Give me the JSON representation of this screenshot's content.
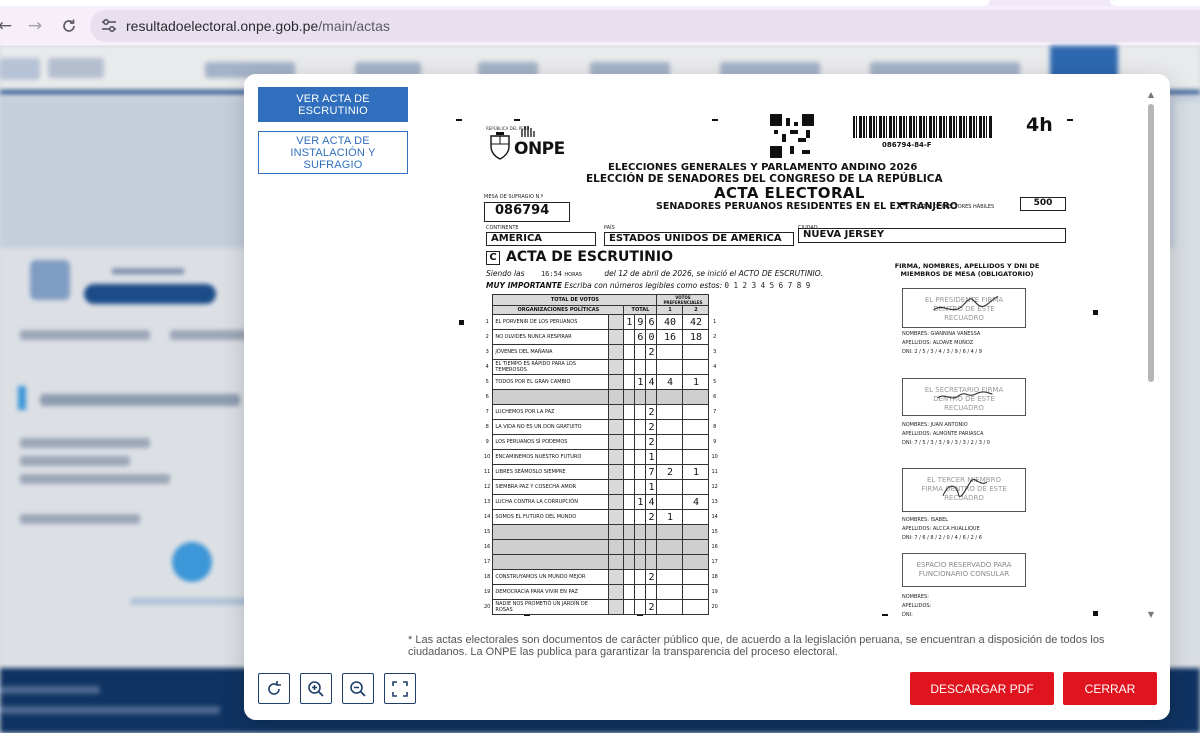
{
  "browser": {
    "url_host": "resultadoelectoral.onpe.gob.pe",
    "url_path": "/main/actas"
  },
  "modal": {
    "tab_acta_escrutinio": "VER ACTA DE ESCRUTINIO",
    "tab_acta_instalacion": "VER ACTA DE INSTALACIÓN Y SUFRAGIO",
    "note": "* Las actas electorales son documentos de carácter público que, de acuerdo a la legislación peruana, se encuentran a disposición de todos los ciudadanos. La ONPE las publica para garantizar la transparencia del proceso electoral.",
    "download_label": "DESCARGAR PDF",
    "close_label": "CERRAR"
  },
  "acta": {
    "corner_code": "4h",
    "barcode_number": "086794-84-F",
    "republica": "REPÚBLICA DEL PERÚ",
    "onpe": "ONPE",
    "title1": "ELECCIONES GENERALES Y PARLAMENTO ANDINO 2026",
    "title2": "ELECCIÓN DE SENADORES DEL CONGRESO DE LA REPÚBLICA",
    "title3": "ACTA ELECTORAL",
    "title4": "SENADORES PERUANOS RESIDENTES EN EL EXTRANJERO",
    "mesa_label": "MESA DE SUFRAGIO N.º",
    "mesa_value": "086794",
    "electores_label": "TOTAL DE ELECTORES HÁBILES",
    "electores_value": "500",
    "continente_label": "CONTINENTE",
    "continente_value": "AMERICA",
    "pais_label": "PAÍS",
    "pais_value": "ESTADOS UNIDOS DE AMERICA",
    "ciudad_label": "CIUDAD",
    "ciudad_value": "NUEVA JERSEY",
    "section_letter": "C",
    "section_title": "ACTA DE ESCRUTINIO",
    "siendo_prefix": "Siendo las",
    "siendo_time": "16:54",
    "siendo_horas": "HORAS",
    "siendo_suffix": "del 12 de abril de 2026, se inició el ACTO DE ESCRUTINIO.",
    "muy_importante": "MUY IMPORTANTE",
    "muy_text": "Escriba con números legibles como estos:",
    "digits_sample": "0 1 2 3 4 5 6 7 8 9",
    "table_header_total_votos": "TOTAL DE VOTOS",
    "table_header_votos_pref": "VOTOS PREFERENCIALES",
    "table_header_org": "ORGANIZACIONES POLÍTICAS",
    "table_header_total": "TOTAL",
    "table_header_p1": "1",
    "table_header_p2": "2",
    "rows": [
      {
        "n": "1",
        "org": "EL PORVENIR DE LOS PERUANOS",
        "total": [
          "1",
          "9",
          "6"
        ],
        "p1": "40",
        "p2": "42"
      },
      {
        "n": "2",
        "org": "NO OLVIDES NUNCA RESPIRAR",
        "total": [
          "",
          "6",
          "0"
        ],
        "p1": "16",
        "p2": "18"
      },
      {
        "n": "3",
        "org": "JÓVENES DEL MAÑANA",
        "total": [
          "",
          "",
          "2"
        ],
        "p1": "",
        "p2": ""
      },
      {
        "n": "4",
        "org": "EL TIEMPO ES RÁPIDO PARA LOS TEMEROSOS",
        "total": [
          "",
          "",
          ""
        ],
        "p1": "",
        "p2": ""
      },
      {
        "n": "5",
        "org": "TODOS POR EL GRAN CAMBIO",
        "total": [
          "",
          "1",
          "4"
        ],
        "p1": "4",
        "p2": "1"
      },
      {
        "n": "6",
        "org": "",
        "total": [
          "",
          "",
          ""
        ],
        "p1": "",
        "p2": ""
      },
      {
        "n": "7",
        "org": "LUCHEMOS POR LA PAZ",
        "total": [
          "",
          "",
          "2"
        ],
        "p1": "",
        "p2": ""
      },
      {
        "n": "8",
        "org": "LA VIDA NO ES UN DON GRATUITO",
        "total": [
          "",
          "",
          "2"
        ],
        "p1": "",
        "p2": ""
      },
      {
        "n": "9",
        "org": "LOS PERUANOS SÍ PODEMOS",
        "total": [
          "",
          "",
          "2"
        ],
        "p1": "",
        "p2": ""
      },
      {
        "n": "10",
        "org": "ENCAMINEMOS NUESTRO FUTURO",
        "total": [
          "",
          "",
          "1"
        ],
        "p1": "",
        "p2": ""
      },
      {
        "n": "11",
        "org": "LIBRES SEÁMOSLO SIEMPRE",
        "total": [
          "",
          "",
          "7"
        ],
        "p1": "2",
        "p2": "1"
      },
      {
        "n": "12",
        "org": "SIEMBRA PAZ Y COSECHA AMOR",
        "total": [
          "",
          "",
          "1"
        ],
        "p1": "",
        "p2": ""
      },
      {
        "n": "13",
        "org": "LUCHA CONTRA LA CORRUPCIÓN",
        "total": [
          "",
          "1",
          "4"
        ],
        "p1": "",
        "p2": "4"
      },
      {
        "n": "14",
        "org": "SOMOS EL FUTURO DEL MUNDO",
        "total": [
          "",
          "",
          "2"
        ],
        "p1": "1",
        "p2": ""
      },
      {
        "n": "15",
        "org": "",
        "total": [
          "",
          "",
          ""
        ],
        "p1": "",
        "p2": ""
      },
      {
        "n": "16",
        "org": "",
        "total": [
          "",
          "",
          ""
        ],
        "p1": "",
        "p2": ""
      },
      {
        "n": "17",
        "org": "",
        "total": [
          "",
          "",
          ""
        ],
        "p1": "",
        "p2": ""
      },
      {
        "n": "18",
        "org": "CONSTRUYAMOS UN MUNDO MEJOR",
        "total": [
          "",
          "",
          "2"
        ],
        "p1": "",
        "p2": ""
      },
      {
        "n": "19",
        "org": "DEMOCRACIA PARA VIVIR EN PAZ",
        "total": [
          "",
          "",
          ""
        ],
        "p1": "",
        "p2": ""
      },
      {
        "n": "20",
        "org": "NADIE NOS PROMETIÓ UN JARDÍN DE ROSAS",
        "total": [
          "",
          "",
          "2"
        ],
        "p1": "",
        "p2": ""
      }
    ],
    "firma_title": "FIRMA, NOMBRES, APELLIDOS Y DNI DE MIEMBROS DE MESA (OBLIGATORIO)",
    "sig1": "EL PRESIDENTE FIRMA DENTRO DE ESTE RECUADRO",
    "sig2": "EL SECRETARIO FIRMA DENTRO DE ESTE RECUADRO",
    "sig3": "EL TERCER MIEMBRO FIRMA DENTRO DE ESTE RECUADRO",
    "sig4": "ESPACIO RESERVADO PARA FUNCIONARIO CONSULAR",
    "nombres_label": "NOMBRES:",
    "apellidos_label": "APELLIDOS:",
    "dni_label": "DNI:",
    "m1_nombres": "GIANNINA VANESSA",
    "m1_apellidos": "ALDAVE MUÑOZ",
    "m1_dni": "2 / 5 / 3 / 4 / 3 / 9 / 6 / 4 / 9",
    "m2_nombres": "JUAN ANTONIO",
    "m2_apellidos": "ALMONTE PARIASCA",
    "m2_dni": "7 / 5 / 3 / 3 / 9 / 3 / 3 / 2 / 3 / 0",
    "m3_nombres": "ISABEL",
    "m3_apellidos": "ALCCA HUALLIQUE",
    "m3_dni": "7 / 6 / 8 / 2 / 0 / 4 / 6 / 2 / 6",
    "colors": {
      "primary": "#2f6fbd",
      "danger": "#e0141e"
    }
  },
  "icons": [
    "tune-icon",
    "rotate-icon",
    "zoom-in-icon",
    "zoom-out-icon",
    "fullscreen-icon",
    "back-arrow-icon",
    "forward-arrow-icon",
    "reload-icon"
  ]
}
